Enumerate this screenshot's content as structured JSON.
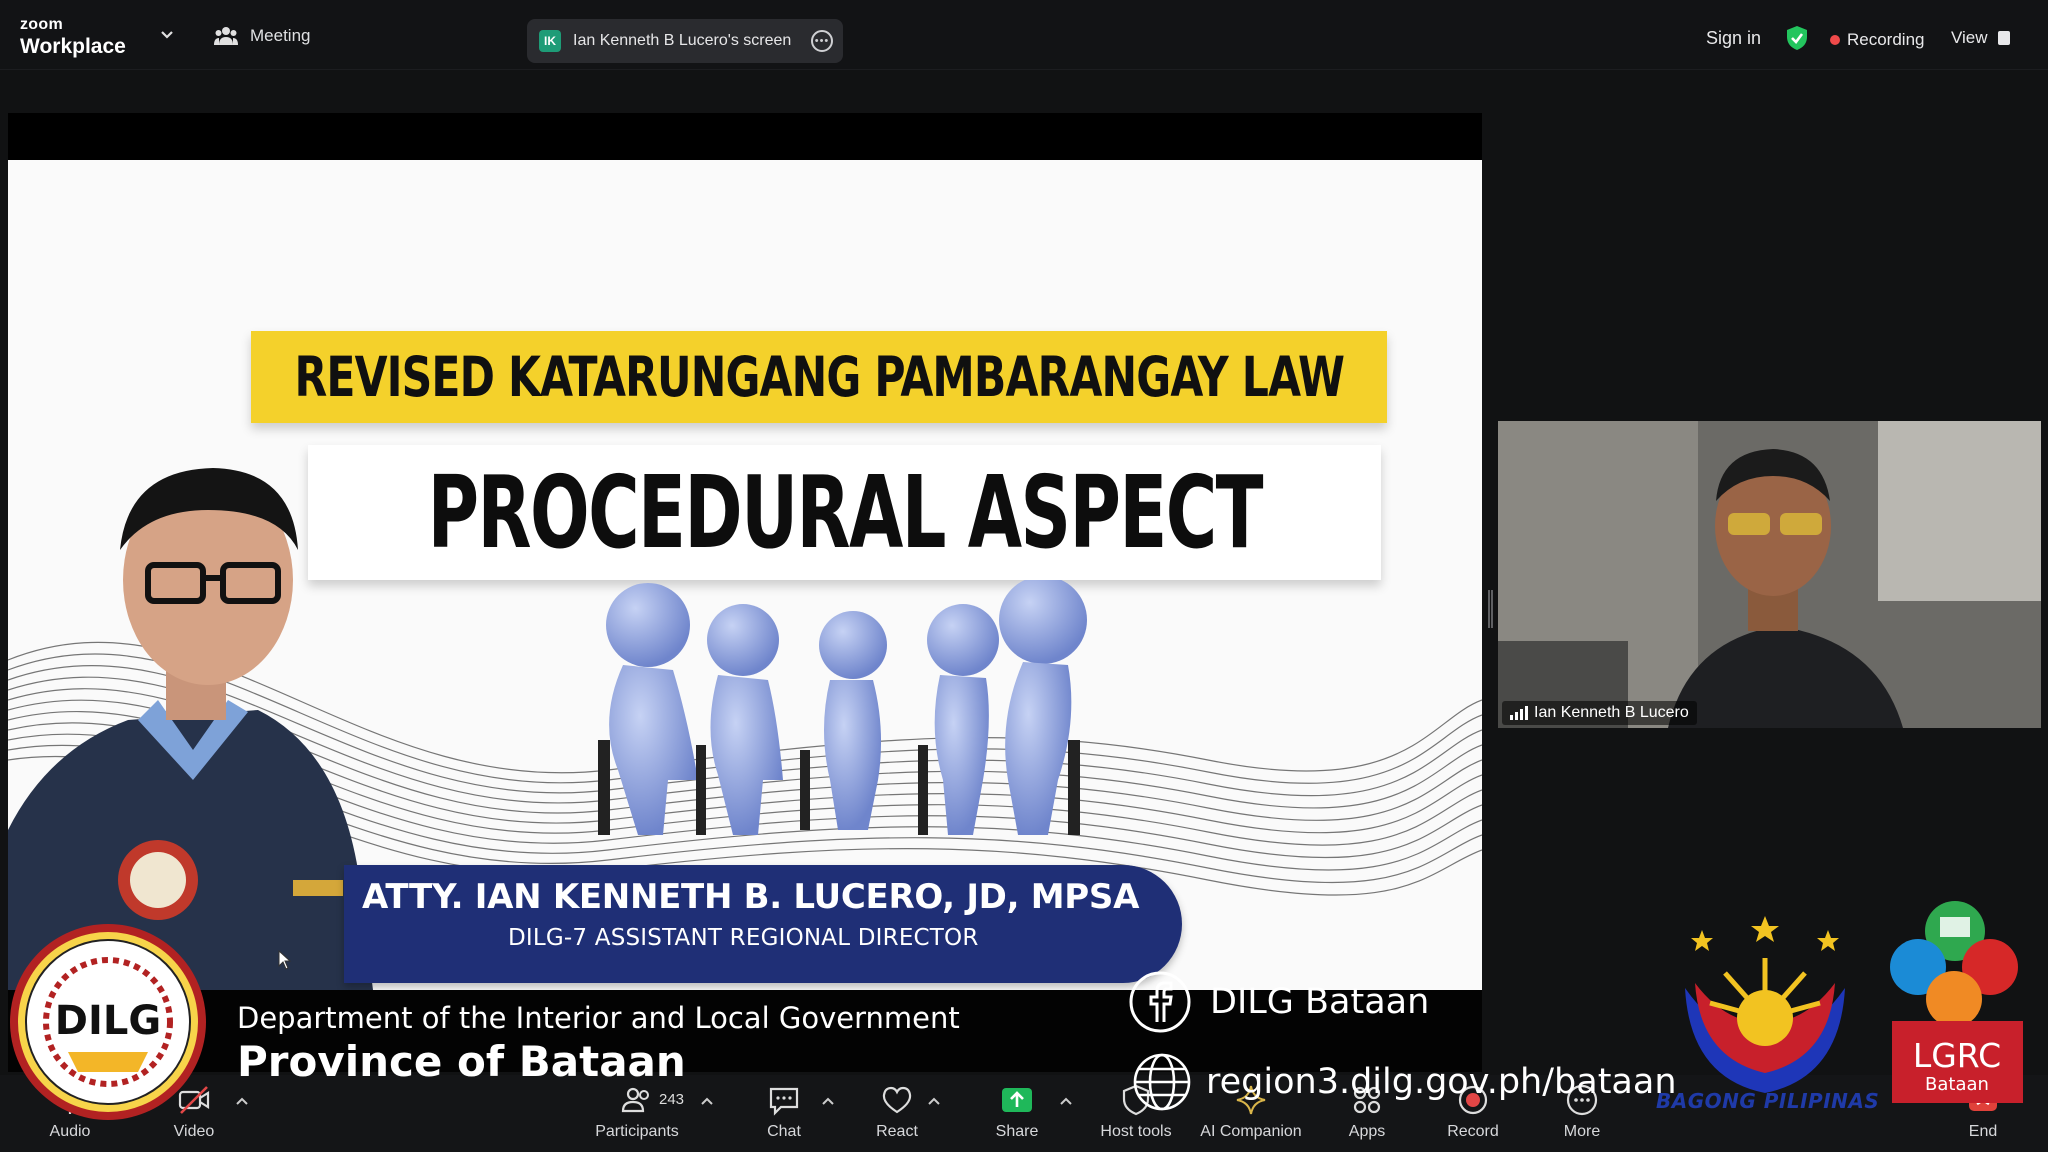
{
  "topbar": {
    "brand_small": "zoom",
    "brand_large": "Workplace",
    "meeting_label": "Meeting",
    "screen_share_initials": "IK",
    "screen_share_label": "Ian Kenneth B Lucero's screen",
    "sign_in": "Sign in",
    "recording": "Recording",
    "view": "View"
  },
  "slide": {
    "banner_top": "REVISED KATARUNGANG PAMBARANGAY LAW",
    "banner_main": "PROCEDURAL ASPECT",
    "presenter_name": "ATTY. IAN KENNETH B. LUCERO, JD, MPSA",
    "presenter_title": "DILG-7 ASSISTANT REGIONAL DIRECTOR"
  },
  "participant": {
    "name": "Ian Kenneth B Lucero"
  },
  "overlay": {
    "seal_text": "DILG",
    "department": "Department of the Interior and Local Government",
    "province": "Province of Bataan",
    "facebook": "DILG Bataan",
    "website": "region3.dilg.gov.ph/bataan",
    "bagong_pilipinas": "BAGONG PILIPINAS",
    "lgrc": "LGRC",
    "lgrc_sub": "Bataan"
  },
  "toolbar": {
    "audio": "Audio",
    "video": "Video",
    "participants": "Participants",
    "participant_count": "243",
    "chat": "Chat",
    "react": "React",
    "share": "Share",
    "host_tools": "Host tools",
    "ai_companion": "AI Companion",
    "apps": "Apps",
    "record": "Record",
    "more": "More",
    "end": "End"
  },
  "colors": {
    "background": "#111213",
    "share_green": "#1fb85a",
    "recording_red": "#f04a4a",
    "slide_banner_yellow": "#f4d12b",
    "slide_badge_navy": "#1f2f76",
    "security_green": "#23c55e"
  }
}
